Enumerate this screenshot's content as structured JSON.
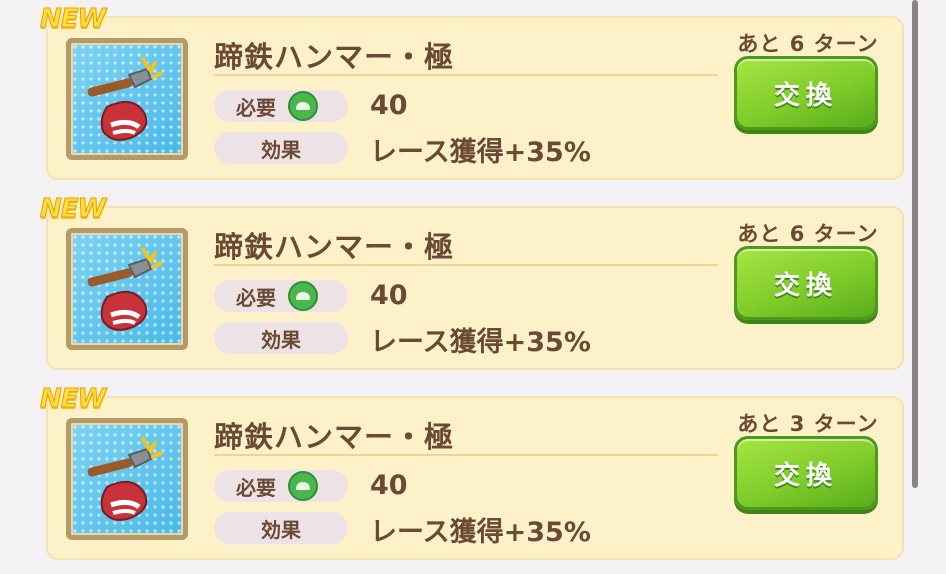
{
  "items": [
    {
      "badge": "NEW",
      "name": "蹄鉄ハンマー・極",
      "required_label": "必要",
      "required_value": "40",
      "effect_label": "効果",
      "effect_value": "レース獲得+35%",
      "turns_left": "あと 6 ターン",
      "button_label": "交換",
      "icon": "horseshoe-hammer-icon"
    },
    {
      "badge": "NEW",
      "name": "蹄鉄ハンマー・極",
      "required_label": "必要",
      "required_value": "40",
      "effect_label": "効果",
      "effect_value": "レース獲得+35%",
      "turns_left": "あと 6 ターン",
      "button_label": "交換",
      "icon": "horseshoe-hammer-icon"
    },
    {
      "badge": "NEW",
      "name": "蹄鉄ハンマー・極",
      "required_label": "必要",
      "required_value": "40",
      "effect_label": "効果",
      "effect_value": "レース獲得+35%",
      "turns_left": "あと 3 ターン",
      "button_label": "交換",
      "icon": "horseshoe-hammer-icon"
    }
  ],
  "colors": {
    "card_bg": "#fdf1c9",
    "text_brown": "#6b4a33",
    "button_green": "#7fcc2a",
    "new_badge": "#ffe035"
  }
}
